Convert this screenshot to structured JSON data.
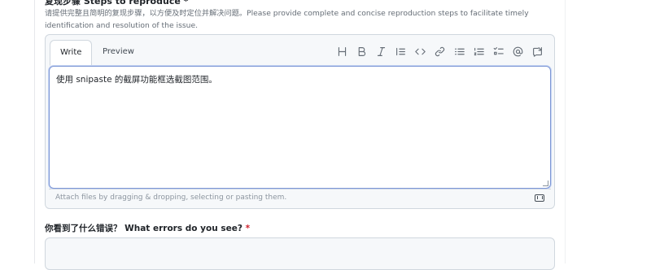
{
  "section": {
    "prev_label_cut": "复现步骤  Steps to reproduce *",
    "description": "请提供完整且简明的复现步骤，以方便及时定位并解决问题。Please provide complete and concise reproduction steps to facilitate timely identification and resolution of the issue."
  },
  "editor": {
    "tabs": {
      "write": "Write",
      "preview": "Preview"
    },
    "toolbar": [
      {
        "name": "heading-icon",
        "glyph": "H"
      },
      {
        "name": "bold-icon",
        "glyph": "B"
      },
      {
        "name": "italic-icon",
        "glyph": "I"
      },
      {
        "name": "quote-icon",
        "glyph": "quote"
      },
      {
        "name": "code-icon",
        "glyph": "code"
      },
      {
        "name": "link-icon",
        "glyph": "link"
      },
      {
        "name": "unordered-list-icon",
        "glyph": "ul"
      },
      {
        "name": "ordered-list-icon",
        "glyph": "ol"
      },
      {
        "name": "task-list-icon",
        "glyph": "task"
      },
      {
        "name": "mention-icon",
        "glyph": "@"
      },
      {
        "name": "reference-icon",
        "glyph": "ref"
      }
    ],
    "content": "使用 snipaste 的截屏功能框选截图范围。",
    "attach_hint": "Attach files by dragging & dropping, selecting or pasting them.",
    "markdown_icon": "markdown-icon"
  },
  "next_question": {
    "label": "你看到了什么错误？ What errors do you see?",
    "required_mark": "*"
  },
  "colors": {
    "focus_border": "#7d97d6",
    "required": "#cf222e",
    "muted_text": "#656d76"
  }
}
